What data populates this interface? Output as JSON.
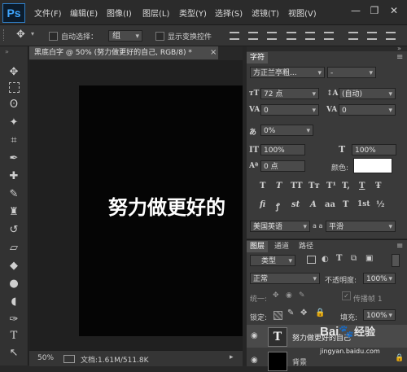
{
  "app": {
    "logo": "Ps"
  },
  "menu": [
    "文件(F)",
    "编辑(E)",
    "图像(I)",
    "图层(L)",
    "类型(Y)",
    "选择(S)",
    "滤镜(T)",
    "视图(V)"
  ],
  "window_controls": {
    "minimize": "—",
    "restore": "❐",
    "close": "✕"
  },
  "options": {
    "auto_select_label": "自动选择：",
    "auto_select_value": "组",
    "show_transform_label": "显示变换控件"
  },
  "document": {
    "tab_title": "黑底白字 @ 50% (努力做更好的自己, RGB/8) *",
    "close": "×",
    "canvas_text": "努力做更好的",
    "zoom": "50%",
    "doc_info": "文档:1.61M/511.8K"
  },
  "character": {
    "tab": "字符",
    "font_family": "方正兰亭粗...",
    "font_style": "-",
    "size": "72 点",
    "leading": "(自动)",
    "kerning": "0",
    "tracking": "0",
    "scale_pct": "0%",
    "vertical_scale": "100%",
    "horizontal_scale": "100%",
    "baseline_shift": "0 点",
    "color_label": "颜色:",
    "text_color": "#ffffff",
    "style_buttons": [
      "T",
      "T",
      "TT",
      "Tт",
      "T¹",
      "T,",
      "T",
      "Ŧ"
    ],
    "opentype_buttons": [
      "fi",
      "ꝭ",
      "st",
      "A",
      "aa",
      "T",
      "1st",
      "½"
    ],
    "language": "美国英语",
    "aa_label": "a a",
    "antialias": "平滑"
  },
  "layers": {
    "tabs": [
      "图层",
      "通道",
      "路径"
    ],
    "filter_kind": "类型",
    "blend_mode": "正常",
    "opacity_label": "不透明度:",
    "opacity": "100%",
    "unify_label": "统一:",
    "propagate_label": "传播帧 1",
    "lock_label": "锁定:",
    "fill_label": "填充:",
    "fill": "100%",
    "items": [
      {
        "name": "努力做更好的自己",
        "thumb": "T"
      },
      {
        "name": "背景",
        "thumb": ""
      }
    ]
  },
  "watermark": {
    "brand": "Bai",
    "brand2": "经验",
    "url": "jingyan.baidu.com"
  }
}
